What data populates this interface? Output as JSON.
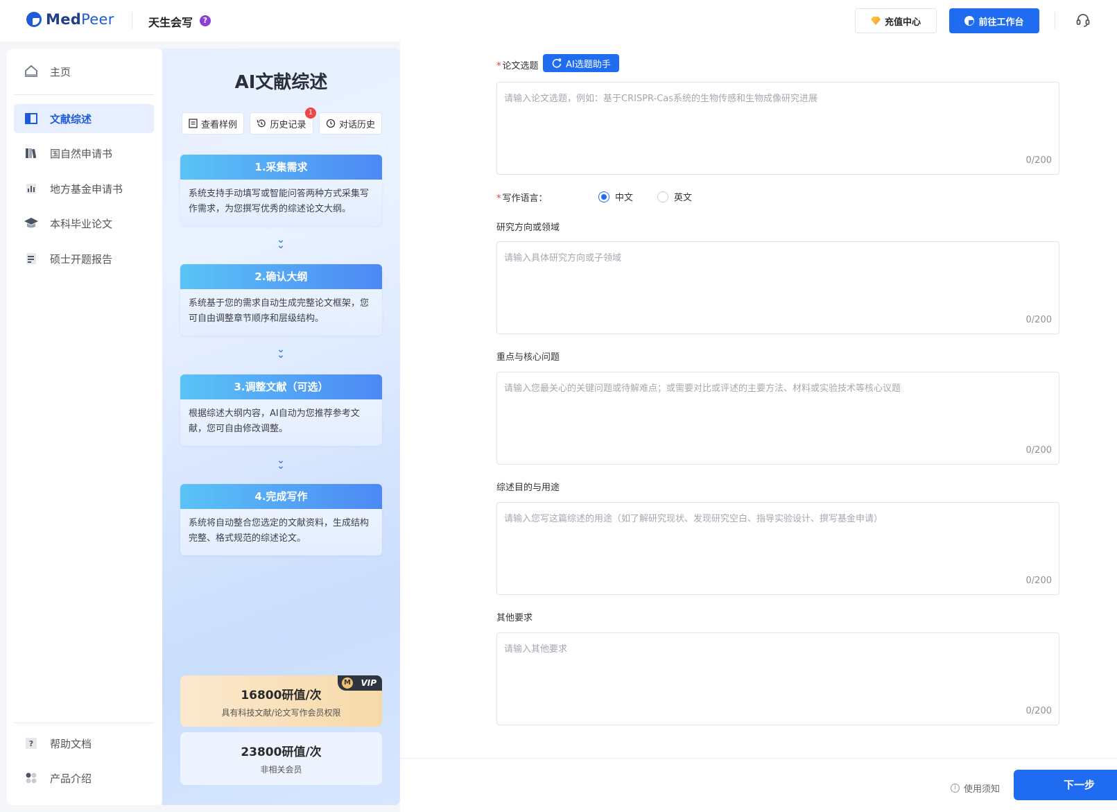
{
  "header": {
    "logo_text_a": "Med",
    "logo_text_b": "Peer",
    "product_name": "天生会写",
    "help_badge": "?",
    "recharge_label": "充值中心",
    "workspace_label": "前往工作台"
  },
  "sidebar": {
    "home": "主页",
    "items": [
      {
        "label": "文献综述",
        "icon": "book-open-icon",
        "active": true
      },
      {
        "label": "国自然申请书",
        "icon": "books-icon",
        "active": false
      },
      {
        "label": "地方基金申请书",
        "icon": "bar-chart-icon",
        "active": false
      },
      {
        "label": "本科毕业论文",
        "icon": "graduation-cap-icon",
        "active": false
      },
      {
        "label": "硕士开题报告",
        "icon": "document-icon",
        "active": false
      }
    ],
    "help_docs": "帮助文档",
    "product_intro": "产品介绍"
  },
  "panel": {
    "title": "AI文献综述",
    "btn_sample": "查看样例",
    "btn_history": "历史记录",
    "history_badge": "1",
    "btn_chat": "对话历史",
    "steps": [
      {
        "title": "1.采集需求",
        "desc": "系统支持手动填写或智能问答两种方式采集写作需求，为您撰写优秀的综述论文大纲。"
      },
      {
        "title": "2.确认大纲",
        "desc": "系统基于您的需求自动生成完整论文框架，您可自由调整章节顺序和层级结构。"
      },
      {
        "title": "3.调整文献（可选）",
        "desc": "根据综述大纲内容，AI自动为您推荐参考文献，您可自由修改调整。"
      },
      {
        "title": "4.完成写作",
        "desc": "系统将自动整合您选定的文献资料，生成结构完整、格式规范的综述论文。"
      }
    ],
    "price_vip": {
      "amount": "16800研值/次",
      "desc": "具有科技文献/论文写作会员权限",
      "tag": "VIP",
      "tag_mark": "M"
    },
    "price_normal": {
      "amount": "23800研值/次",
      "desc": "非相关会员"
    }
  },
  "form": {
    "topic_label": "论文选题",
    "ai_assist_label": "AI选题助手",
    "topic_placeholder": "请输入论文选题，例如：基于CRISPR-Cas系统的生物传感和生物成像研究进展",
    "language_label": "写作语言：",
    "lang_zh": "中文",
    "lang_en": "英文",
    "lang_selected": "中文",
    "direction_label": "研究方向或领域",
    "direction_placeholder": "请输入具体研究方向或子领域",
    "core_label": "重点与核心问题",
    "core_placeholder": "请输入您最关心的关键问题或待解难点；或需要对比或评述的主要方法、材料或实验技术等核心议题",
    "purpose_label": "综述目的与用途",
    "purpose_placeholder": "请输入您写这篇综述的用途（如了解研究现状、发现研究空白、指导实验设计、撰写基金申请）",
    "other_label": "其他要求",
    "other_placeholder": "请输入其他要求",
    "counter": "0/200",
    "required_mark": "*"
  },
  "footer": {
    "notice": "使用须知",
    "next": "下一步"
  },
  "colors": {
    "primary": "#1f6cf0",
    "active_bg": "#e7efff",
    "required": "#e33333"
  }
}
